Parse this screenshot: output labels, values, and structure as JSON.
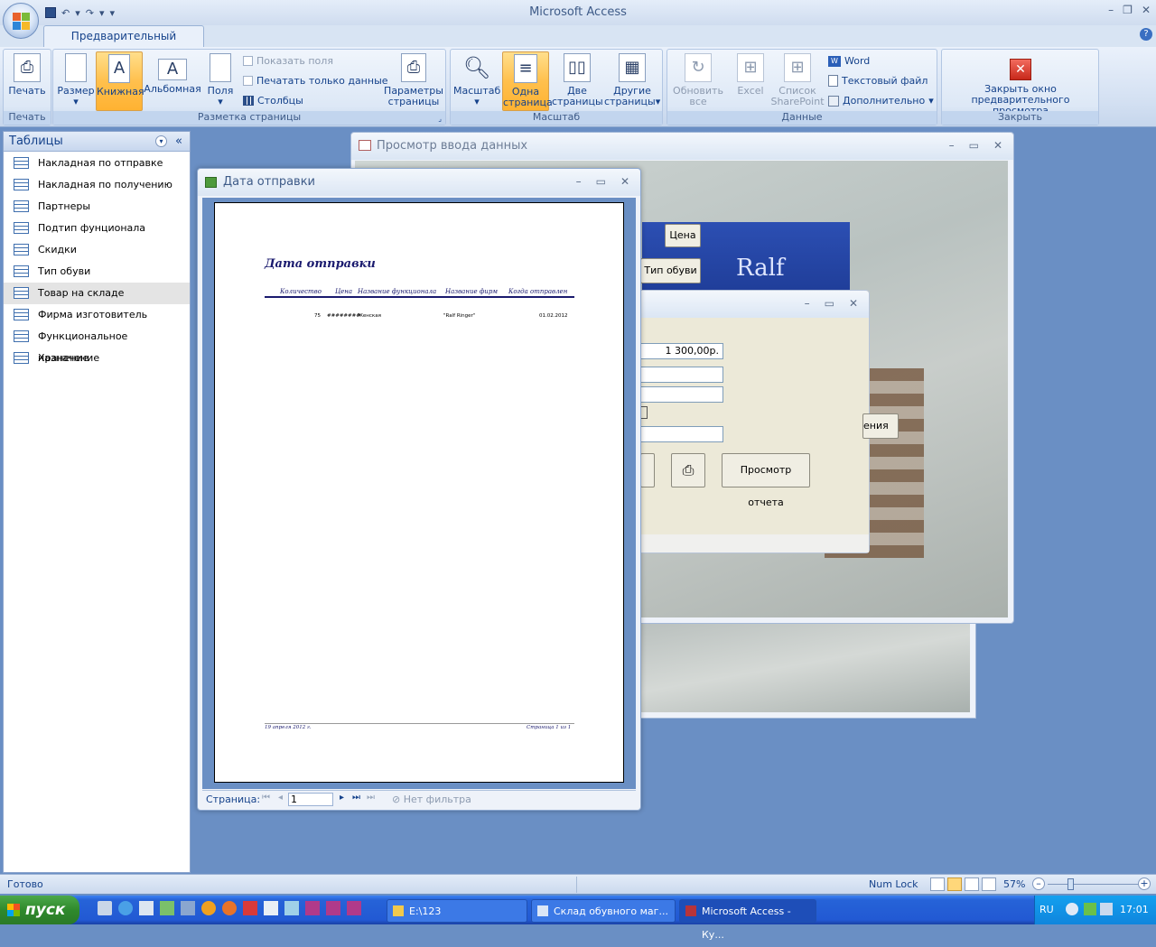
{
  "app": {
    "title": "Microsoft Access",
    "tab_label": "Предварительный просмотр",
    "help": "?"
  },
  "ribbon": {
    "print_group": {
      "title": "Печать",
      "print_label": "Печать"
    },
    "page_layout_group": {
      "title": "Разметка страницы",
      "size_label": "Размер",
      "portrait_label": "Книжная",
      "landscape_label": "Альбомная",
      "margins_label": "Поля",
      "show_fields_label": "Показать поля",
      "print_data_only_label": "Печатать только данные",
      "columns_label": "Столбцы",
      "page_setup_label_1": "Параметры",
      "page_setup_label_2": "страницы"
    },
    "zoom_group": {
      "title": "Масштаб",
      "zoom_label": "Масштаб",
      "one_page_1": "Одна",
      "one_page_2": "страница",
      "two_pages_1": "Две",
      "two_pages_2": "страницы",
      "more_pages_1": "Другие",
      "more_pages_2": "страницы"
    },
    "data_group": {
      "title": "Данные",
      "refresh_1": "Обновить",
      "refresh_2": "все",
      "excel_label": "Excel",
      "sharepoint_1": "Список",
      "sharepoint_2": "SharePoint",
      "word_label": "Word",
      "text_file_label": "Текстовый файл",
      "more_label": "Дополнительно"
    },
    "close_group": {
      "title": "Закрыть",
      "close_1": "Закрыть окно",
      "close_2": "предварительного просмотра"
    }
  },
  "nav": {
    "header": "Таблицы",
    "items": [
      {
        "label": "Накладная по отправке"
      },
      {
        "label": "Накладная по получению"
      },
      {
        "label": "Партнеры"
      },
      {
        "label": "Подтип фунционала"
      },
      {
        "label": "Скидки"
      },
      {
        "label": "Тип обуви"
      },
      {
        "label": "Товар на складе"
      },
      {
        "label": "Фирма изготовитель"
      },
      {
        "label": "Функциональное назначение"
      },
      {
        "label": "Хранение"
      }
    ]
  },
  "bg_window": {
    "title": "Просмотр ввода данных",
    "btn_price": "Цена",
    "btn_shoe_type": "Тип обуви",
    "btn_partial": "ения",
    "field_price": "1 300,00р.",
    "btn_report_preview": "Просмотр отчета",
    "store_sign": "Ralf"
  },
  "report": {
    "window_title": "Дата отправки",
    "heading": "Дата отправки",
    "columns": [
      "Количество",
      "Цена",
      "Название функционала",
      "Название фирм",
      "Когда отправлен"
    ],
    "rows": [
      [
        "75",
        "########",
        "Женская",
        "\"Ralf Ringer\"",
        "01.02.2012"
      ]
    ],
    "footer_date": "19 апреля 2012 г.",
    "footer_page": "Страница 1 из 1",
    "nav_label": "Страница:",
    "page_value": "1",
    "filter_label": "Нет фильтра"
  },
  "status": {
    "ready": "Готово",
    "numlock": "Num Lock",
    "zoom": "57%"
  },
  "taskbar": {
    "start": "пуск",
    "tasks": [
      "E:\\123",
      "Склад обувного маг...",
      "Microsoft Access - Ку..."
    ],
    "lang": "RU",
    "time": "17:01"
  }
}
